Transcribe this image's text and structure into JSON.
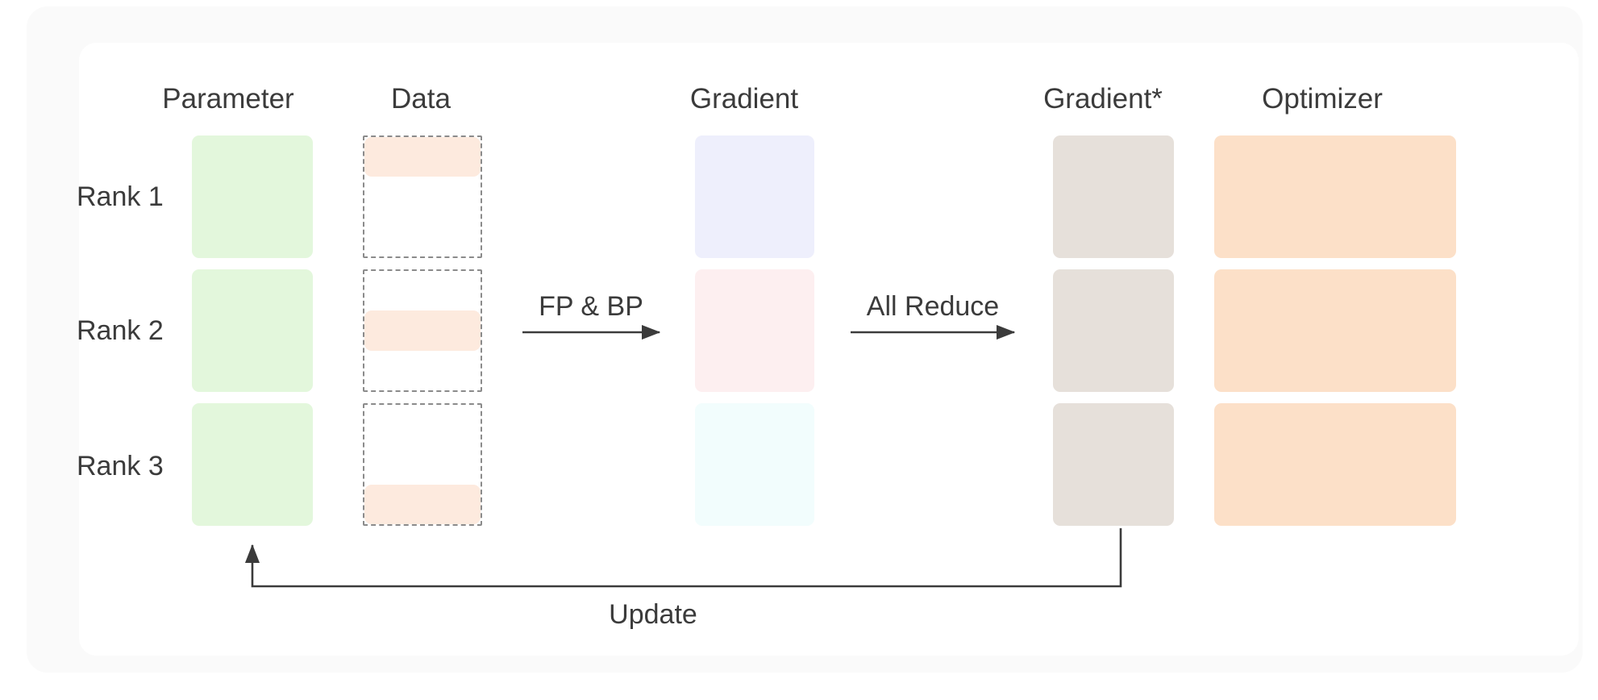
{
  "diagram": {
    "title_columns": [
      {
        "id": "parameter",
        "label": "Parameter"
      },
      {
        "id": "data",
        "label": "Data"
      },
      {
        "id": "gradient",
        "label": "Gradient"
      },
      {
        "id": "gradient_star",
        "label": "Gradient*"
      },
      {
        "id": "optimizer",
        "label": "Optimizer"
      }
    ],
    "rows": [
      {
        "id": "rank1",
        "label": "Rank 1"
      },
      {
        "id": "rank2",
        "label": "Rank 2"
      },
      {
        "id": "rank3",
        "label": "Rank 3"
      }
    ],
    "arrows": [
      {
        "id": "fp-bp",
        "label": "FP & BP"
      },
      {
        "id": "all-reduce",
        "label": "All Reduce"
      },
      {
        "id": "update",
        "label": "Update"
      }
    ],
    "cells": {
      "parameter": [
        {
          "row": "Rank 1",
          "color": "#e3f7dc"
        },
        {
          "row": "Rank 2",
          "color": "#e3f7dc"
        },
        {
          "row": "Rank 3",
          "color": "#e3f7dc"
        }
      ],
      "data": [
        {
          "row": "Rank 1",
          "slice_position": "top",
          "slice_color": "#fdeade",
          "frame": "dashed"
        },
        {
          "row": "Rank 2",
          "slice_position": "middle",
          "slice_color": "#fdeade",
          "frame": "dashed"
        },
        {
          "row": "Rank 3",
          "slice_position": "bottom",
          "slice_color": "#fdeade",
          "frame": "dashed"
        }
      ],
      "gradient": [
        {
          "row": "Rank 1",
          "color": "#eeeffc"
        },
        {
          "row": "Rank 2",
          "color": "#fdeff0"
        },
        {
          "row": "Rank 3",
          "color": "#f2fdfd"
        }
      ],
      "gradient_star": [
        {
          "row": "Rank 1",
          "color": "#e6e0da"
        },
        {
          "row": "Rank 2",
          "color": "#e6e0da"
        },
        {
          "row": "Rank 3",
          "color": "#e6e0da"
        }
      ],
      "optimizer": [
        {
          "row": "Rank 1",
          "color": "#fce0c8"
        },
        {
          "row": "Rank 2",
          "color": "#fce0c8"
        },
        {
          "row": "Rank 3",
          "color": "#fce0c8"
        }
      ]
    },
    "colors": {
      "canvas": "#ffffff",
      "outer_panel": "#fafafa",
      "card": "#ffffff",
      "text": "#3b3b3b",
      "arrow_stroke": "#3b3b3b",
      "dashed_border": "#8b8b8b",
      "parameter_box": "#e3f7dc",
      "data_slice": "#fdeade",
      "gradient_rank1": "#eeeffc",
      "gradient_rank2": "#fdeff0",
      "gradient_rank3": "#f2fdfd",
      "gradient_star_box": "#e6e0da",
      "optimizer_box": "#fce0c8"
    }
  }
}
